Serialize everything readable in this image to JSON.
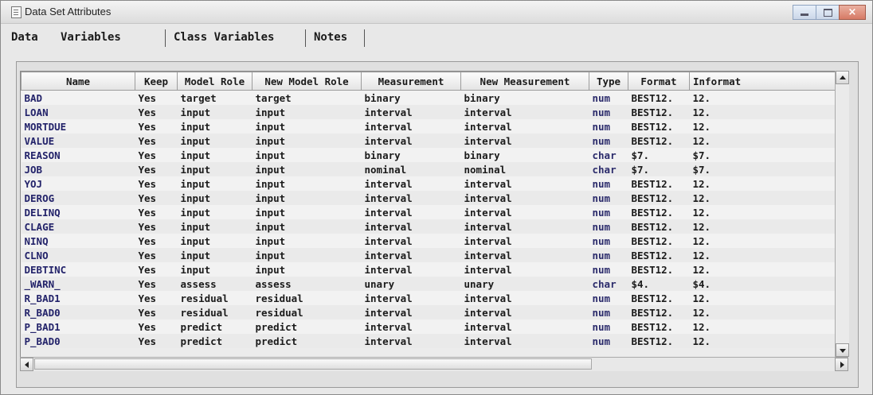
{
  "window": {
    "title": "Data Set Attributes"
  },
  "tabs": [
    {
      "label": "Data"
    },
    {
      "label": "Variables"
    },
    {
      "label": "Class Variables"
    },
    {
      "label": "Notes"
    }
  ],
  "table": {
    "columns": [
      "Name",
      "Keep",
      "Model Role",
      "New Model Role",
      "Measurement",
      "New Measurement",
      "Type",
      "Format",
      "Informat"
    ],
    "rows": [
      [
        "BAD",
        "Yes",
        "target",
        "target",
        "binary",
        "binary",
        "num",
        "BEST12.",
        "12."
      ],
      [
        "LOAN",
        "Yes",
        "input",
        "input",
        "interval",
        "interval",
        "num",
        "BEST12.",
        "12."
      ],
      [
        "MORTDUE",
        "Yes",
        "input",
        "input",
        "interval",
        "interval",
        "num",
        "BEST12.",
        "12."
      ],
      [
        "VALUE",
        "Yes",
        "input",
        "input",
        "interval",
        "interval",
        "num",
        "BEST12.",
        "12."
      ],
      [
        "REASON",
        "Yes",
        "input",
        "input",
        "binary",
        "binary",
        "char",
        "$7.",
        "$7."
      ],
      [
        "JOB",
        "Yes",
        "input",
        "input",
        "nominal",
        "nominal",
        "char",
        "$7.",
        "$7."
      ],
      [
        "YOJ",
        "Yes",
        "input",
        "input",
        "interval",
        "interval",
        "num",
        "BEST12.",
        "12."
      ],
      [
        "DEROG",
        "Yes",
        "input",
        "input",
        "interval",
        "interval",
        "num",
        "BEST12.",
        "12."
      ],
      [
        "DELINQ",
        "Yes",
        "input",
        "input",
        "interval",
        "interval",
        "num",
        "BEST12.",
        "12."
      ],
      [
        "CLAGE",
        "Yes",
        "input",
        "input",
        "interval",
        "interval",
        "num",
        "BEST12.",
        "12."
      ],
      [
        "NINQ",
        "Yes",
        "input",
        "input",
        "interval",
        "interval",
        "num",
        "BEST12.",
        "12."
      ],
      [
        "CLNO",
        "Yes",
        "input",
        "input",
        "interval",
        "interval",
        "num",
        "BEST12.",
        "12."
      ],
      [
        "DEBTINC",
        "Yes",
        "input",
        "input",
        "interval",
        "interval",
        "num",
        "BEST12.",
        "12."
      ],
      [
        "_WARN_",
        "Yes",
        "assess",
        "assess",
        "unary",
        "unary",
        "char",
        "$4.",
        "$4."
      ],
      [
        "R_BAD1",
        "Yes",
        "residual",
        "residual",
        "interval",
        "interval",
        "num",
        "BEST12.",
        "12."
      ],
      [
        "R_BAD0",
        "Yes",
        "residual",
        "residual",
        "interval",
        "interval",
        "num",
        "BEST12.",
        "12."
      ],
      [
        "P_BAD1",
        "Yes",
        "predict",
        "predict",
        "interval",
        "interval",
        "num",
        "BEST12.",
        "12."
      ],
      [
        "P_BAD0",
        "Yes",
        "predict",
        "predict",
        "interval",
        "interval",
        "num",
        "BEST12.",
        "12."
      ]
    ]
  }
}
